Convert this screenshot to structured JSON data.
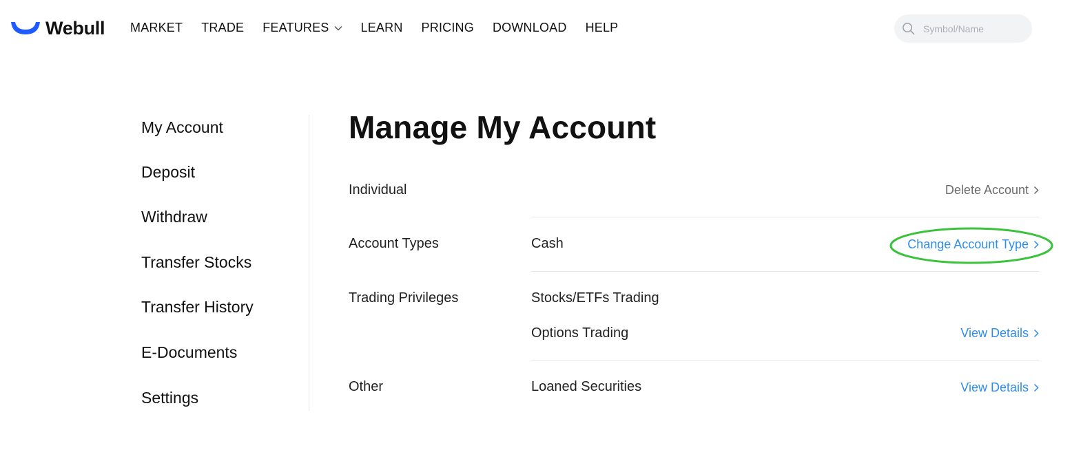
{
  "header": {
    "logo_text": "Webull",
    "nav": [
      {
        "label": "MARKET",
        "has_dropdown": false
      },
      {
        "label": "TRADE",
        "has_dropdown": false
      },
      {
        "label": "FEATURES",
        "has_dropdown": true
      },
      {
        "label": "LEARN",
        "has_dropdown": false
      },
      {
        "label": "PRICING",
        "has_dropdown": false
      },
      {
        "label": "DOWNLOAD",
        "has_dropdown": false
      },
      {
        "label": "HELP",
        "has_dropdown": false
      }
    ],
    "search": {
      "placeholder": "Symbol/Name",
      "value": "",
      "icon": "search-icon"
    }
  },
  "sidebar": {
    "items": [
      {
        "label": "My Account"
      },
      {
        "label": "Deposit"
      },
      {
        "label": "Withdraw"
      },
      {
        "label": "Transfer Stocks"
      },
      {
        "label": "Transfer History"
      },
      {
        "label": "E-Documents"
      },
      {
        "label": "Settings"
      }
    ]
  },
  "main": {
    "title": "Manage My Account",
    "account": {
      "label": "Individual",
      "link": "Delete Account"
    },
    "account_types": {
      "label": "Account Types",
      "value": "Cash",
      "link": "Change Account Type"
    },
    "trading_privileges": {
      "label": "Trading Privileges",
      "items": [
        {
          "value": "Stocks/ETFs Trading",
          "link": ""
        },
        {
          "value": "Options Trading",
          "link": "View Details"
        }
      ]
    },
    "other": {
      "label": "Other",
      "value": "Loaned Securities",
      "link": "View Details"
    }
  },
  "colors": {
    "brand_blue": "#1f5bff",
    "link_blue": "#2d8cf0",
    "link_gray": "#6b6b6b",
    "highlight_green": "#3ac23a"
  }
}
